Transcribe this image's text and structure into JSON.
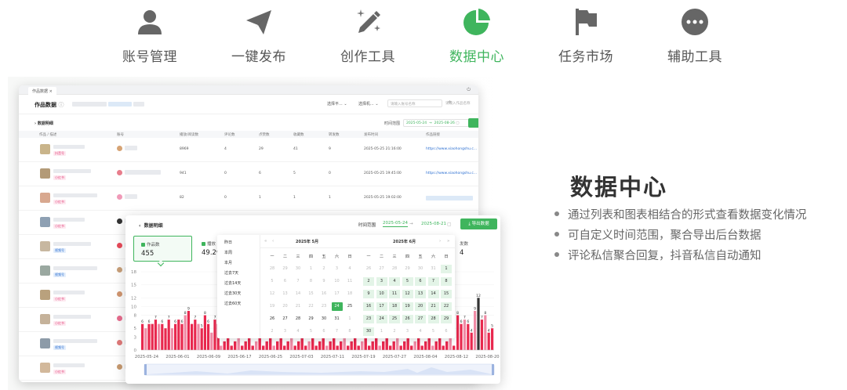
{
  "nav": {
    "items": [
      {
        "label": "账号管理",
        "icon": "user-icon"
      },
      {
        "label": "一键发布",
        "icon": "paper-plane-icon"
      },
      {
        "label": "创作工具",
        "icon": "magic-pen-icon"
      },
      {
        "label": "数据中心",
        "icon": "pie-chart-icon",
        "active": true
      },
      {
        "label": "任务市场",
        "icon": "flag-icon"
      },
      {
        "label": "辅助工具",
        "icon": "more-icon"
      }
    ],
    "active_color": "#3fb55d",
    "inactive_color": "#555555"
  },
  "feature": {
    "title": "数据中心",
    "bullets": [
      "通过列表和图表相结合的形式查看数据变化情况",
      "可自定义时间范围，聚合导出后台数据",
      "评论私信聚合回复，抖音私信自动通知"
    ]
  },
  "list_window": {
    "tab_label": "作品数据",
    "title": "作品数据",
    "filter1": "选择平...",
    "filter2": "选择机...",
    "search_placeholder": "请输入账号名称",
    "search2_placeholder": "请输入作品名称",
    "subtitle": "数据明细",
    "time_range_label": "时间范围",
    "date_start": "2025-05-24",
    "date_end": "2025-08-26",
    "columns": [
      "作品 / 描述",
      "账号",
      "播放/阅读数",
      "评论数",
      "点赞数",
      "收藏数",
      "转发数",
      "发布时间",
      "作品链接"
    ],
    "rows": [
      {
        "tag": "抖音号",
        "play": "8969",
        "comments": "4",
        "likes": "29",
        "favs": "41",
        "shares": "9",
        "time": "2025-05-25 21:16:00",
        "link": "https://www.xiaohongshu.c..."
      },
      {
        "tag": "小红书",
        "play": "941",
        "comments": "0",
        "likes": "6",
        "favs": "5",
        "shares": "0",
        "time": "2025-05-25 19:45:00",
        "link": "https://www.xiaohongshu.c..."
      },
      {
        "tag": "小红书",
        "play": "82",
        "comments": "0",
        "likes": "1",
        "favs": "1",
        "shares": "1",
        "time": "2025-05-25 19:02:00",
        "link": ""
      }
    ],
    "extra_tags": [
      "小红书",
      "视频号",
      "视频号",
      "小红书",
      "小红书",
      "视频号",
      "小红书",
      "视频号",
      "小红书"
    ]
  },
  "chart_window": {
    "title": "数据明细",
    "time_range_label": "时间范围",
    "date_start": "2025-05-24",
    "arrow": "→",
    "date_end": "2025-08-21",
    "export_label": "导出数据",
    "cards": [
      {
        "label": "作品数",
        "value": "455"
      },
      {
        "label": "播放",
        "value": "49.2w"
      },
      {
        "label": "发数",
        "value": "4"
      }
    ]
  },
  "date_picker": {
    "presets": [
      "昨日",
      "本周",
      "本月",
      "过去7天",
      "过去14天",
      "过去30天",
      "过去60天"
    ],
    "left_month": "2025年  5月",
    "right_month": "2025年  6月",
    "weekdays": [
      "一",
      "二",
      "三",
      "四",
      "五",
      "六",
      "日"
    ],
    "left_days": [
      [
        "28",
        "29",
        "30",
        "1",
        "2",
        "3",
        "4"
      ],
      [
        "5",
        "6",
        "7",
        "8",
        "9",
        "10",
        "11"
      ],
      [
        "12",
        "13",
        "14",
        "15",
        "16",
        "17",
        "18"
      ],
      [
        "19",
        "20",
        "21",
        "22",
        "23",
        "24",
        "25"
      ],
      [
        "26",
        "27",
        "28",
        "29",
        "30",
        "31",
        "1"
      ],
      [
        "2",
        "3",
        "4",
        "5",
        "6",
        "7",
        "8"
      ]
    ],
    "right_days": [
      [
        "26",
        "27",
        "28",
        "29",
        "30",
        "31",
        "1"
      ],
      [
        "2",
        "3",
        "4",
        "5",
        "6",
        "7",
        "8"
      ],
      [
        "9",
        "10",
        "11",
        "12",
        "13",
        "14",
        "15"
      ],
      [
        "16",
        "17",
        "18",
        "19",
        "20",
        "21",
        "22"
      ],
      [
        "23",
        "24",
        "25",
        "26",
        "27",
        "28",
        "29"
      ],
      [
        "30",
        "1",
        "2",
        "3",
        "4",
        "5",
        "6"
      ]
    ],
    "selected": "24"
  },
  "chart_data": {
    "type": "bar",
    "ylim": [
      0,
      18
    ],
    "yticks": [
      "18",
      "15",
      "12",
      "10",
      "8",
      "5",
      "3",
      "0"
    ],
    "xlabels": [
      "2025-05-24",
      "2025-06-01",
      "2025-06-09",
      "2025-06-17",
      "2025-06-25",
      "2025-07-03",
      "2025-07-11",
      "2025-07-19",
      "2025-07-27",
      "2025-08-04",
      "2025-08-12",
      "2025-08-20"
    ],
    "left_values": [
      6,
      5,
      6,
      6,
      7,
      6,
      6,
      5,
      7,
      5,
      6,
      7,
      6,
      8,
      9,
      6,
      7,
      6,
      5,
      8,
      6,
      4,
      7,
      6
    ],
    "right_values": [
      8,
      6,
      7,
      6,
      4,
      9,
      12,
      7,
      8,
      4,
      5
    ],
    "series_colors": [
      "#e8284e",
      "#f08aa5",
      "#333333"
    ]
  }
}
